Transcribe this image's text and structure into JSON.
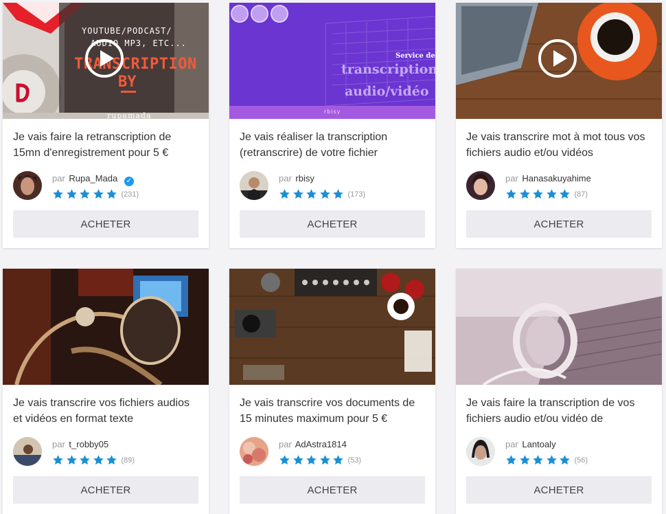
{
  "gigs": [
    {
      "title": "Je vais faire la retranscription de 15mn d'enregistrement pour 5 €",
      "by_label": "par",
      "seller": "Rupa_Mada",
      "verified": true,
      "count": "(231)",
      "button": "ACHETER",
      "thumb_text": {
        "line1": "YOUTUBE/PODCAST/",
        "line2": "AUDIO MP3, ETC...",
        "line3": "TRANSCRIPTION",
        "line4": "BY",
        "line5": "rupamada"
      }
    },
    {
      "title": "Je vais réaliser la transcription (retranscrire) de votre fichier",
      "by_label": "par",
      "seller": "rbisy",
      "count": "(173)",
      "button": "ACHETER",
      "thumb_text": {
        "line1": "Service de",
        "line2": "transcription",
        "line3": "audio/vidéo",
        "line4": "rbisy"
      }
    },
    {
      "title": "Je vais transcrire mot à mot tous vos fichiers audio et/ou vidéos",
      "by_label": "par",
      "seller": "Hanasakuyahime",
      "count": "(87)",
      "button": "ACHETER"
    },
    {
      "title": "Je vais transcrire vos fichiers audios et vidéos en format texte",
      "by_label": "par",
      "seller": "t_robby05",
      "count": "(89)",
      "button": "ACHETER"
    },
    {
      "title": "Je vais transcrire vos documents de 15 minutes maximum pour 5 €",
      "by_label": "par",
      "seller": "AdAstra1814",
      "count": "(53)",
      "button": "ACHETER"
    },
    {
      "title": "Je vais faire la transcription de vos fichiers audio et/ou vidéo de",
      "by_label": "par",
      "seller": "Lantoaly",
      "count": "(56)",
      "button": "ACHETER"
    }
  ],
  "colors": {
    "star": "#1a8fd6",
    "button_bg": "#ebebf0",
    "verified": "#1d9bf0"
  },
  "icons": {
    "star": "star-icon",
    "play": "play-icon",
    "verified": "verified-badge-icon"
  }
}
